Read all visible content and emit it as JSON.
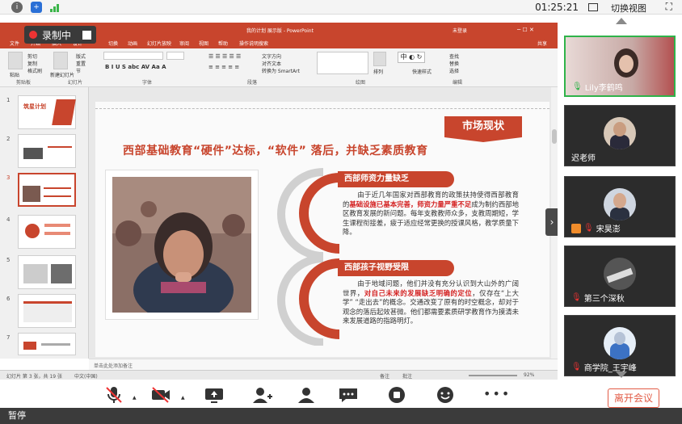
{
  "statusbar": {
    "clock": "01:25:21",
    "switch_view": "切换视图",
    "icons": [
      "info-icon",
      "shield-icon",
      "signal-icon",
      "layout-icon",
      "fullscreen-icon"
    ]
  },
  "recording": {
    "label": "录制中"
  },
  "powerpoint": {
    "title": "我的计划 展示版 - PowerPoint",
    "user": "未登录",
    "share": "共享",
    "tabs": [
      "文件",
      "开始",
      "插入",
      "设计",
      "切换",
      "动画",
      "幻灯片放映",
      "审阅",
      "视图",
      "帮助",
      "操作说明搜索"
    ],
    "ribbon_groups": [
      "剪贴板",
      "幻灯片",
      "字体",
      "段落",
      "绘图",
      "编辑"
    ],
    "ribbon_buttons": {
      "paste": "粘贴",
      "cut": "剪切",
      "copy": "复制",
      "format_painter": "格式刷",
      "new_slide": "新建幻灯片",
      "layout": "版式",
      "reset": "重置",
      "section": "节",
      "text_direction": "文字方向",
      "align_text": "对齐文本",
      "smartart": "转换为 SmartArt",
      "arrange": "排列",
      "quick_styles": "快速样式",
      "find": "查找",
      "replace": "替换",
      "select": "选择"
    },
    "notes_placeholder": "单击此处添加备注",
    "status_left": "幻灯片 第 3 张，共 19 张",
    "status_lang": "中文(中国)",
    "status_notes": "备注",
    "status_comments": "批注",
    "zoom": "92%",
    "thumb_numbers": [
      "1",
      "2",
      "3",
      "4",
      "5",
      "6",
      "7"
    ]
  },
  "slide": {
    "tag": "市场现状",
    "headline": "西部基础教育“硬件”达标，“软件” 落后，并缺乏素质教育",
    "thumb1_title": "筑星计划",
    "section1": {
      "title": "西部师资力量缺乏",
      "text_a": "由于近几年国家对西部教育的政策扶持使得西部教育的",
      "text_hl": "基础设施已基本完善，师资力量严重不足",
      "text_b": "成为制约西部地区教育发展的新问题。每年支教教师众多，支教周期短，学生课程衔接差，疲于适应经常更换的授课风格，教学质量下降。"
    },
    "section2": {
      "title": "西部孩子视野受限",
      "text_a": "由于地域问题，他们并没有充分认识到大山外的广阔世界，",
      "text_hl": "对自己未来的发展缺乏明确的定位",
      "text_b": "，仅存在“上大学” “走出去”的概念。交通改变了原有的时空概念，却对于观念的落后起效甚微。他们都需要素质研学教育作为摸清未来发展道路的指路明灯。"
    }
  },
  "participants": [
    {
      "name": "Lily李鹤鸣",
      "mic": "on"
    },
    {
      "name": "迟老师",
      "mic": "none"
    },
    {
      "name": "宋昊澎",
      "mic": "muted"
    },
    {
      "name": "第三个深秋",
      "mic": "muted"
    },
    {
      "name": "商学院_王宇峰",
      "mic": "muted"
    }
  ],
  "toolbar": {
    "icons": [
      "mic-muted-icon",
      "camera-off-icon",
      "share-screen-icon",
      "invite-icon",
      "members-icon",
      "chat-icon",
      "record-icon",
      "reaction-icon",
      "more-icon"
    ],
    "leave": "离开会议"
  },
  "pause_label": "暂停",
  "colors": {
    "accent": "#c8452d",
    "highlight": "#d42222",
    "leave": "#e25b45"
  }
}
